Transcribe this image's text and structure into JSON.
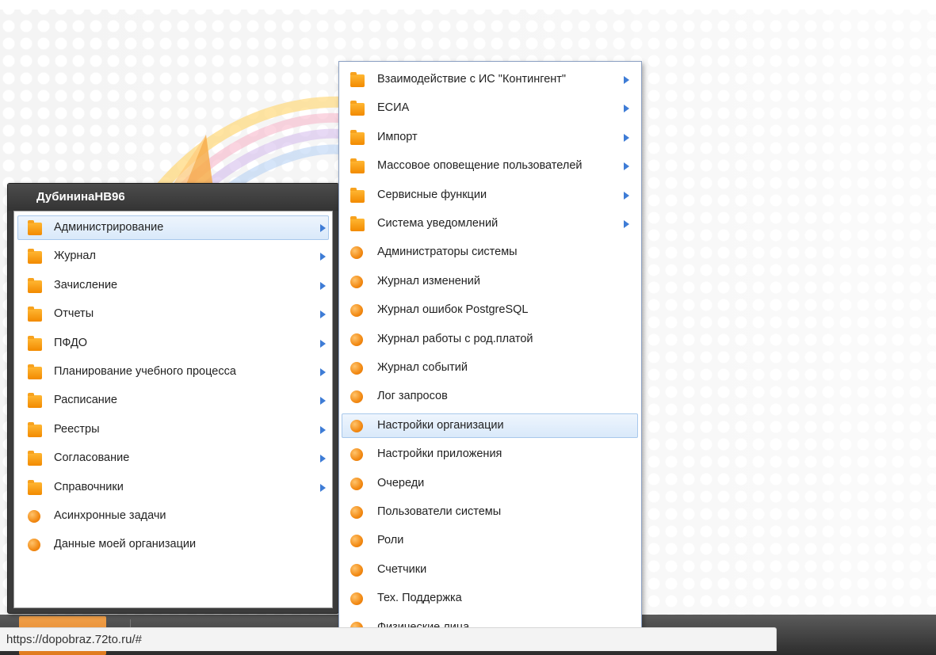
{
  "user": {
    "name": "ДубининаНВ96"
  },
  "main_menu": {
    "items": [
      {
        "label": "Администрирование",
        "icon": "folder-icon",
        "has_submenu": true,
        "selected": true
      },
      {
        "label": "Журнал",
        "icon": "folder-icon",
        "has_submenu": true
      },
      {
        "label": "Зачисление",
        "icon": "folder-icon",
        "has_submenu": true
      },
      {
        "label": "Отчеты",
        "icon": "folder-icon",
        "has_submenu": true
      },
      {
        "label": "ПФДО",
        "icon": "folder-icon",
        "has_submenu": true
      },
      {
        "label": "Планирование учебного процесса",
        "icon": "folder-icon",
        "has_submenu": true
      },
      {
        "label": "Расписание",
        "icon": "folder-icon",
        "has_submenu": true
      },
      {
        "label": "Реестры",
        "icon": "folder-icon",
        "has_submenu": true
      },
      {
        "label": "Согласование",
        "icon": "folder-icon",
        "has_submenu": true
      },
      {
        "label": "Справочники",
        "icon": "folder-icon",
        "has_submenu": true
      },
      {
        "label": "Асинхронные задачи",
        "icon": "orange-dot-icon",
        "has_submenu": false
      },
      {
        "label": "Данные моей организации",
        "icon": "orange-dot-icon",
        "has_submenu": false
      }
    ]
  },
  "submenu": {
    "items": [
      {
        "label": "Взаимодействие с ИС \"Контингент\"",
        "icon": "folder-icon",
        "has_submenu": true
      },
      {
        "label": "ЕСИА",
        "icon": "folder-icon",
        "has_submenu": true
      },
      {
        "label": "Импорт",
        "icon": "folder-icon",
        "has_submenu": true
      },
      {
        "label": "Массовое оповещение пользователей",
        "icon": "folder-icon",
        "has_submenu": true
      },
      {
        "label": "Сервисные функции",
        "icon": "folder-icon",
        "has_submenu": true
      },
      {
        "label": "Система уведомлений",
        "icon": "folder-icon",
        "has_submenu": true
      },
      {
        "label": "Администраторы системы",
        "icon": "orange-dot-icon",
        "has_submenu": false
      },
      {
        "label": "Журнал изменений",
        "icon": "orange-dot-icon",
        "has_submenu": false
      },
      {
        "label": "Журнал ошибок PostgreSQL",
        "icon": "orange-dot-icon",
        "has_submenu": false
      },
      {
        "label": "Журнал работы с род.платой",
        "icon": "orange-dot-icon",
        "has_submenu": false
      },
      {
        "label": "Журнал событий",
        "icon": "orange-dot-icon",
        "has_submenu": false
      },
      {
        "label": "Лог запросов",
        "icon": "orange-dot-icon",
        "has_submenu": false
      },
      {
        "label": "Настройки организации",
        "icon": "orange-dot-icon",
        "has_submenu": false,
        "selected": true
      },
      {
        "label": "Настройки приложения",
        "icon": "orange-dot-icon",
        "has_submenu": false
      },
      {
        "label": "Очереди",
        "icon": "orange-dot-icon",
        "has_submenu": false
      },
      {
        "label": "Пользователи системы",
        "icon": "orange-dot-icon",
        "has_submenu": false
      },
      {
        "label": "Роли",
        "icon": "orange-dot-icon",
        "has_submenu": false
      },
      {
        "label": "Счетчики",
        "icon": "orange-dot-icon",
        "has_submenu": false
      },
      {
        "label": "Тех. Поддержка",
        "icon": "orange-dot-icon",
        "has_submenu": false
      },
      {
        "label": "Физические лица",
        "icon": "orange-dot-icon",
        "has_submenu": false
      }
    ]
  },
  "status_bar": {
    "url": "https://dopobraz.72to.ru/#"
  },
  "colors": {
    "accent_orange": "#f28a00",
    "arrow_blue": "#3e7cd6",
    "selection_bg": "#d9e9fa",
    "menu_header_bg": "#3b3b3b"
  }
}
